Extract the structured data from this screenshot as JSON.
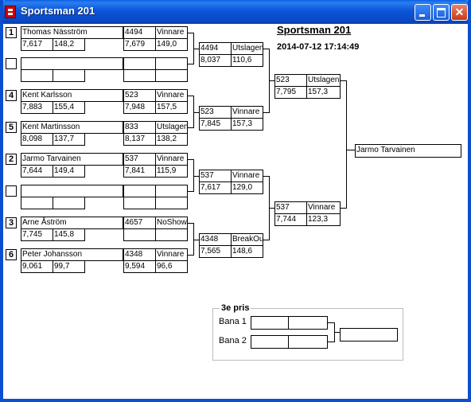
{
  "window": {
    "title": "Sportsman 201"
  },
  "header": {
    "title": "Sportsman 201",
    "timestamp": "2014-07-12 17:14:49"
  },
  "seeds": [
    "1",
    "4",
    "5",
    "2",
    "3",
    "6"
  ],
  "r1": [
    {
      "name": "Thomas Näsström",
      "v1": "7,617",
      "v2": "148,2"
    },
    {
      "name": "",
      "v1": "",
      "v2": ""
    },
    {
      "name": "Kent Karlsson",
      "v1": "7,883",
      "v2": "155,4"
    },
    {
      "name": "Kent Martinsson",
      "v1": "8,098",
      "v2": "137,7"
    },
    {
      "name": "Jarmo Tarvainen",
      "v1": "7,644",
      "v2": "149,4"
    },
    {
      "name": "",
      "v1": "",
      "v2": ""
    },
    {
      "name": "Arne Åström",
      "v1": "7,745",
      "v2": "145,8"
    },
    {
      "name": "Peter Johansson",
      "v1": "9,061",
      "v2": "99,7"
    }
  ],
  "r2": [
    {
      "id": "4494",
      "result": "Vinnare",
      "v1": "7,679",
      "v2": "149,0"
    },
    {
      "id": "",
      "result": "",
      "v1": "",
      "v2": ""
    },
    {
      "id": "523",
      "result": "Vinnare",
      "v1": "7,948",
      "v2": "157,5"
    },
    {
      "id": "833",
      "result": "Utslagen",
      "v1": "8,137",
      "v2": "138,2"
    },
    {
      "id": "537",
      "result": "Vinnare",
      "v1": "7,841",
      "v2": "115,9"
    },
    {
      "id": "",
      "result": "",
      "v1": "",
      "v2": ""
    },
    {
      "id": "4657",
      "result": "NoShow",
      "v1": "",
      "v2": ""
    },
    {
      "id": "4348",
      "result": "Vinnare",
      "v1": "9,594",
      "v2": "96,6"
    }
  ],
  "r3": [
    {
      "id": "4494",
      "result": "Utslagen",
      "v1": "8,037",
      "v2": "110,6"
    },
    {
      "id": "523",
      "result": "Vinnare",
      "v1": "7,845",
      "v2": "157,3"
    },
    {
      "id": "537",
      "result": "Vinnare",
      "v1": "7,617",
      "v2": "129,0"
    },
    {
      "id": "4348",
      "result": "BreakOut",
      "v1": "7,565",
      "v2": "148,6"
    }
  ],
  "r4": [
    {
      "id": "523",
      "result": "Utslagen",
      "v1": "7,795",
      "v2": "157,3"
    },
    {
      "id": "537",
      "result": "Vinnare",
      "v1": "7,744",
      "v2": "123,3"
    }
  ],
  "winner": "Jarmo Tarvainen",
  "third_place": {
    "title": "3e pris",
    "lane1": "Bana 1",
    "lane2": "Bana 2"
  }
}
